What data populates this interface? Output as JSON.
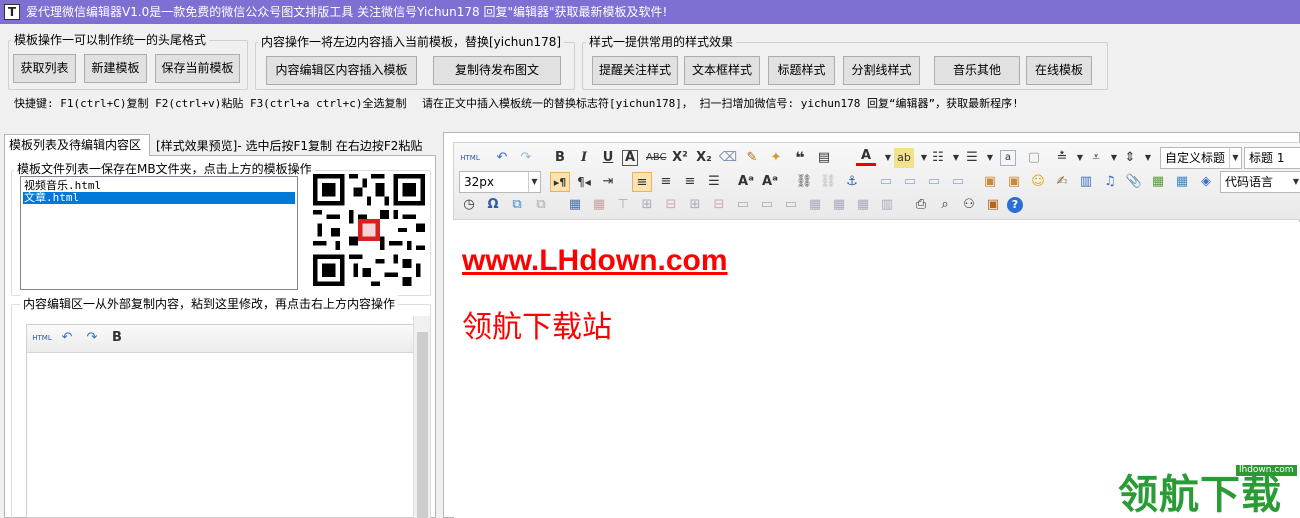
{
  "window": {
    "app_icon_glyph": "T",
    "title": "爱代理微信编辑器V1.0是一款免费的微信公众号图文排版工具 关注微信号Yichun178 回复\"编辑器\"获取最新模板及软件!"
  },
  "groups": {
    "template_ops": {
      "label": "模板操作一可以制作统一的头尾格式",
      "buttons": [
        "获取列表",
        "新建模板",
        "保存当前模板"
      ]
    },
    "content_ops": {
      "label": "内容操作一将左边内容插入当前模板，替换[yichun178]",
      "buttons": [
        "内容编辑区内容插入模板",
        "复制待发布图文"
      ]
    },
    "style_ops": {
      "label": "样式一提供常用的样式效果",
      "buttons": [
        "提醒关注样式",
        "文本框样式",
        "标题样式",
        "分割线样式",
        "音乐其他",
        "在线模板"
      ]
    }
  },
  "shortcuts": "快捷键: F1(ctrl+C)复制  F2(ctrl+v)粘贴 F3(ctrl+a ctrl+c)全选复制",
  "notice": "请在正文中插入模板统一的替换标志符[yichun178]，  扫一扫增加微信号: yichun178 回复“编辑器”，获取最新程序!",
  "tabs": {
    "active": "模板列表及待编辑内容区",
    "preview": "[样式效果预览]- 选中后按F1复制 在右边按F2粘贴"
  },
  "file_panel": {
    "label": "模板文件列表一保存在MB文件夹，点击上方的模板操作",
    "files": [
      "视频音乐.html",
      "文章.html"
    ],
    "selected_index": 1
  },
  "content_area": {
    "label": "内容编辑区一从外部复制内容，粘到这里修改，再点击右上方内容操作",
    "toolbar": {
      "html": "HTML",
      "bold": "B"
    }
  },
  "editor": {
    "toolbar": {
      "html_label": "HTML",
      "font_size": "32px",
      "custom_heading": "自定义标题",
      "heading": "标题 1",
      "code_language": "代码语言"
    },
    "doc": {
      "link_text": "www.LHdown.com",
      "title_text": "领航下载站"
    },
    "colors": {
      "doc_text": "#ff0000",
      "title_bar": "#7e6fd3",
      "selection": "#0078d7"
    }
  },
  "watermark": {
    "site": "lhdown.com",
    "text": "领航下载"
  }
}
